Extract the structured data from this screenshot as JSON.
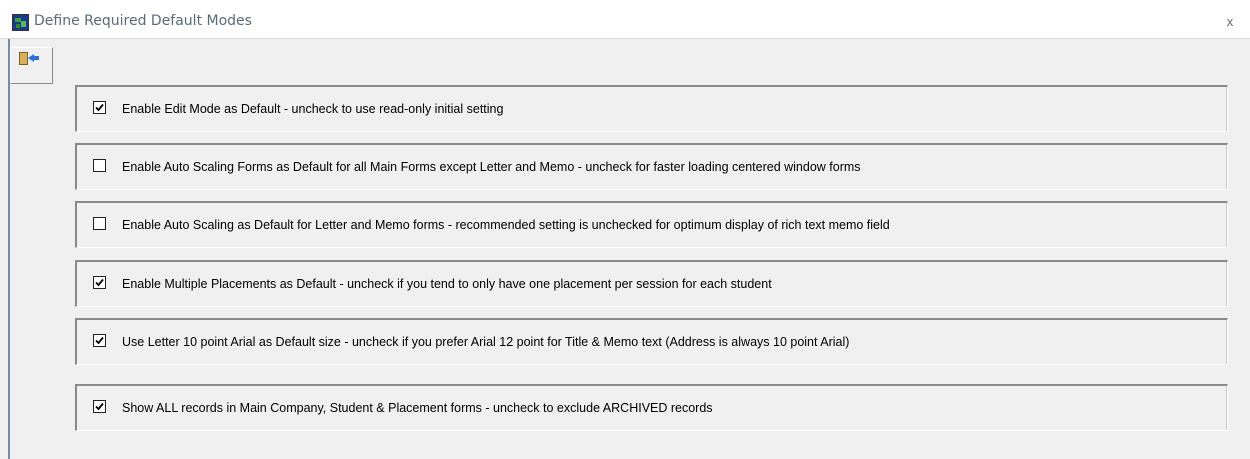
{
  "window": {
    "title": "Define Required Default Modes",
    "close_label": "x"
  },
  "toolbar": {
    "exit_icon": "exit-door-icon"
  },
  "options": [
    {
      "label": "Enable Edit Mode as Default - uncheck to use read-only initial setting",
      "checked": true
    },
    {
      "label": "Enable Auto Scaling Forms as Default for all Main Forms except Letter and Memo - uncheck for faster loading centered window forms",
      "checked": false
    },
    {
      "label": "Enable Auto Scaling as Default for Letter and Memo forms - recommended setting is unchecked for optimum display of rich text memo field",
      "checked": false
    },
    {
      "label": "Enable Multiple Placements as Default - uncheck if you tend to only have one placement per session for each student",
      "checked": true
    },
    {
      "label": "Use Letter 10 point Arial as Default size - uncheck if you prefer Arial 12 point for Title & Memo text (Address is always 10 point Arial)",
      "checked": true
    },
    {
      "label": "Show ALL records in Main Company, Student & Placement forms - uncheck to exclude ARCHIVED records",
      "checked": true
    }
  ]
}
